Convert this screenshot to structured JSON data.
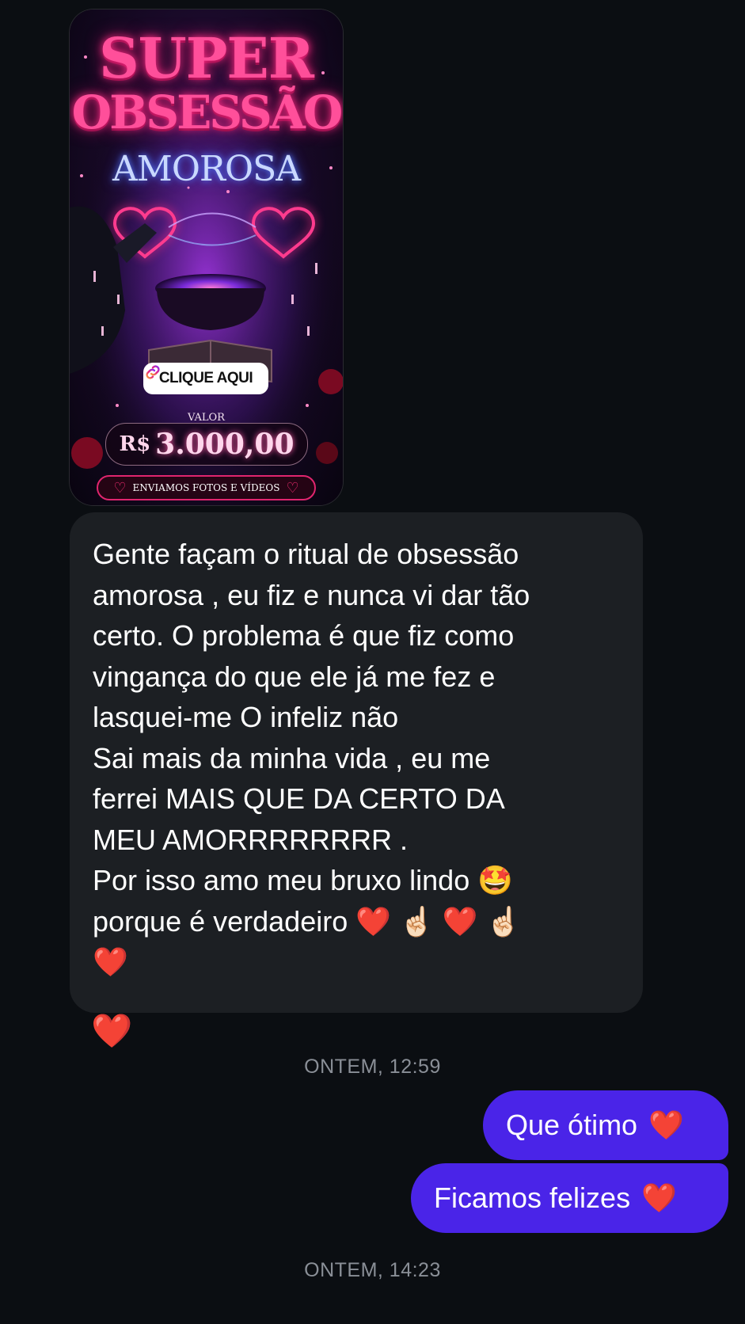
{
  "story": {
    "title_line1": "SUPER",
    "title_line2": "OBSESSÃO",
    "title_line3": "AMOROSA",
    "cta_label": "CLIQUE AQUI",
    "cta_icon": "link-icon",
    "valor_label": "VALOR",
    "price_currency": "R$",
    "price_value": "3.000,00",
    "footer_label": "ENVIAMOS FOTOS E VÍDEOS"
  },
  "incoming_message": {
    "text": "Gente façam o ritual de obsessão\namorosa , eu fiz e nunca vi dar tão\ncerto. O problema é que fiz como\nvingança do que ele já me fez e\nlasquei-me O infeliz não\nSai mais da minha vida , eu me\nferrei MAIS QUE DA CERTO DA\nMEU AMORRRRRRRR .\nPor isso amo meu bruxo lindo 🤩\nporque é verdadeiro ❤️ ☝🏻 ❤️ ☝🏻\n❤️",
    "reaction": "❤️"
  },
  "timestamps": {
    "first": "ONTEM, 12:59",
    "second": "ONTEM, 14:23"
  },
  "outgoing_messages": [
    {
      "text": "Que ótimo",
      "emoji": "❤️"
    },
    {
      "text": "Ficamos felizes",
      "emoji": "❤️"
    }
  ],
  "colors": {
    "background": "#0b0e12",
    "incoming_bubble": "#1c1f23",
    "outgoing_bubble": "#4a24e8",
    "timestamp": "#8a8f97",
    "story_pink": "#ff4f9a"
  }
}
